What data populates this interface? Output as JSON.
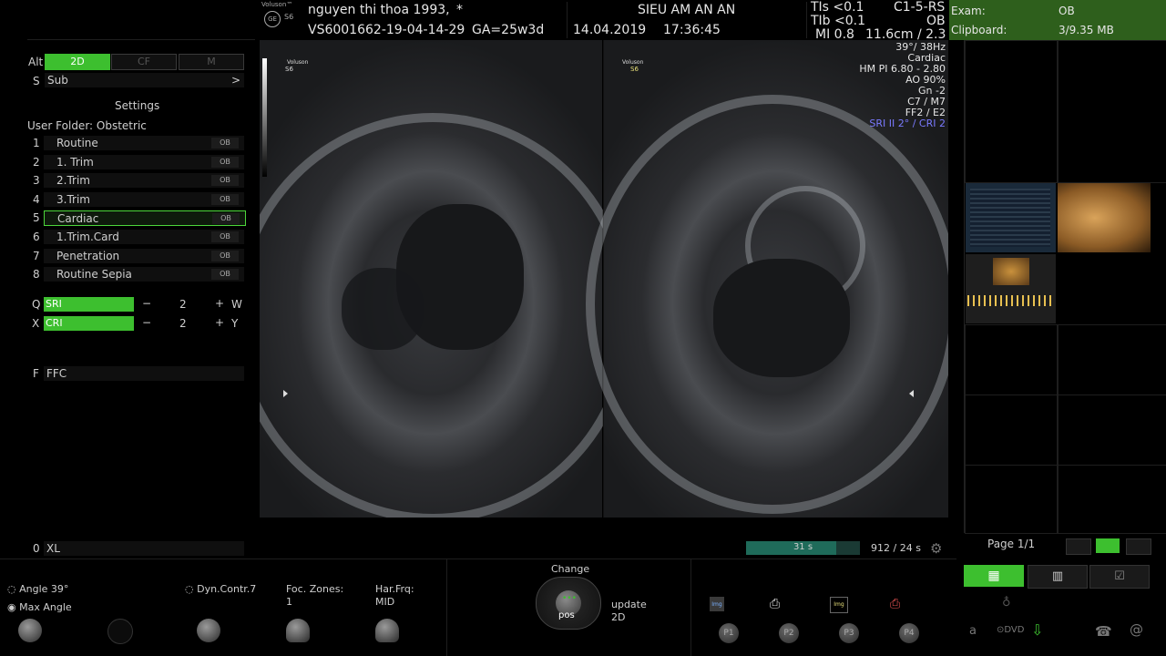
{
  "header": {
    "brand": "Voluson™",
    "model": "S6",
    "patient": "nguyen thi thoa 1993,",
    "asterisk": "*",
    "patient_id": "VS6001662-19-04-14-29",
    "ga": "GA=25w3d",
    "clinic": "SIEU AM AN AN",
    "date": "14.04.2019",
    "time": "17:36:45",
    "tis": "TIs <0.1",
    "tib": "TIb <0.1",
    "mi": "MI 0.8",
    "probe": "C1-5-RS",
    "app": "OB",
    "depth": "11.6cm / 2.3"
  },
  "exam_panel": {
    "exam_label": "Exam:",
    "exam_value": "OB",
    "clipboard_label": "Clipboard:",
    "clipboard_value": "3/9.35 MB"
  },
  "left_panel": {
    "alt": "Alt",
    "modes": [
      "2D",
      "CF",
      "M"
    ],
    "sub_key": "S",
    "sub_label": "Sub",
    "sub_arrow": ">",
    "settings_title": "Settings",
    "user_folder": "User Folder: Obstetric",
    "presets": [
      {
        "num": "1",
        "name": "Routine",
        "tag": "OB"
      },
      {
        "num": "2",
        "name": "1. Trim",
        "tag": "OB"
      },
      {
        "num": "3",
        "name": "2.Trim",
        "tag": "OB"
      },
      {
        "num": "4",
        "name": "3.Trim",
        "tag": "OB"
      },
      {
        "num": "5",
        "name": "Cardiac",
        "tag": "OB"
      },
      {
        "num": "6",
        "name": "1.Trim.Card",
        "tag": "OB"
      },
      {
        "num": "7",
        "name": "Penetration",
        "tag": "OB"
      },
      {
        "num": "8",
        "name": "Routine Sepia",
        "tag": "OB"
      }
    ],
    "sri": {
      "key": "Q",
      "label": "SRI",
      "minus": "−",
      "value": "2",
      "plus": "+",
      "right": "W"
    },
    "cri": {
      "key": "X",
      "label": "CRI",
      "minus": "−",
      "value": "2",
      "plus": "+",
      "right": "Y"
    },
    "ffc": {
      "key": "F",
      "label": "FFC"
    },
    "xl": {
      "key": "0",
      "label": "XL"
    }
  },
  "image_params": {
    "left_logo": "Voluson",
    "left_logo_model": "S6",
    "right_logo": "Voluson",
    "right_logo_model": "S6",
    "lines": [
      "39°/ 38Hz",
      "Cardiac",
      "HM PI 6.80 - 2.80",
      "AO 90%",
      "Gn -2",
      "C7 / M7",
      "FF2 / E2"
    ],
    "sri_line": "SRI II 2° / CRI 2"
  },
  "cine": {
    "progress_label": "31 s",
    "progress_fraction": 0.79,
    "frames": "912 / 24 s"
  },
  "right_panel": {
    "page": "Page 1/1"
  },
  "bottom": {
    "angle": "Angle 39°",
    "max_angle": "Max Angle",
    "dyn_contr": "Dyn.Contr.7",
    "foc_zones_label": "Foc. Zones:",
    "foc_zones_value": "1",
    "har_frq_label": "Har.Frq:",
    "har_frq_value": "MID",
    "change": "Change",
    "pos": "pos",
    "update": "update",
    "update_mode": "2D",
    "img_label": "Img",
    "p_buttons": [
      "P1",
      "P2",
      "P3",
      "P4"
    ],
    "a_label": "a",
    "dvd_label": "DVD",
    "at_label": "@",
    "ge_label": "GE"
  }
}
